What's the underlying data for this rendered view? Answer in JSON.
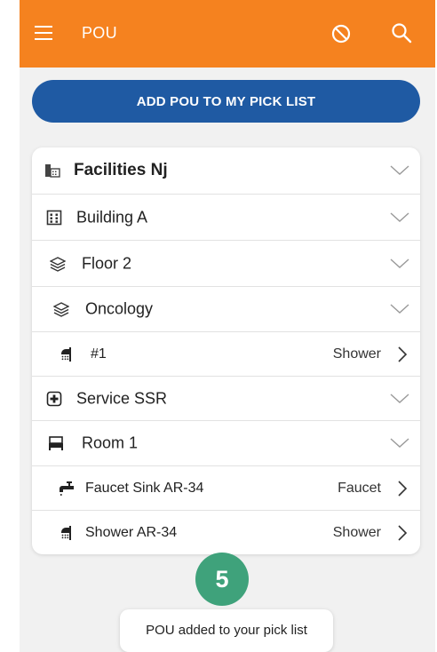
{
  "appbar": {
    "title": "POU",
    "menu_icon": "hamburger-menu-icon",
    "block_icon": "block-icon",
    "search_icon": "search-icon",
    "color": "#f5821f"
  },
  "actions": {
    "add_label": "ADD POU TO MY PICK LIST",
    "button_color": "#1f5aa3"
  },
  "tree": {
    "facility": {
      "label": "Facilities Nj",
      "icon": "facility-icon"
    },
    "building": {
      "label": "Building A",
      "icon": "building-icon"
    },
    "floor": {
      "label": "Floor 2",
      "icon": "layers-icon"
    },
    "department": {
      "label": "Oncology",
      "icon": "layers-icon"
    },
    "department_item": {
      "label": "#1",
      "type": "Shower",
      "icon": "shower-icon"
    },
    "service": {
      "label": "Service SSR",
      "icon": "medical-plus-icon"
    },
    "room": {
      "label": "Room 1",
      "icon": "bed-icon"
    },
    "room_items": [
      {
        "label": "Faucet Sink AR-34",
        "type": "Faucet",
        "icon": "faucet-icon"
      },
      {
        "label": "Shower AR-34",
        "type": "Shower",
        "icon": "shower-icon"
      }
    ]
  },
  "badge": {
    "value": "5",
    "color": "#3fa27b"
  },
  "toast": {
    "message": "POU added to your pick list"
  }
}
